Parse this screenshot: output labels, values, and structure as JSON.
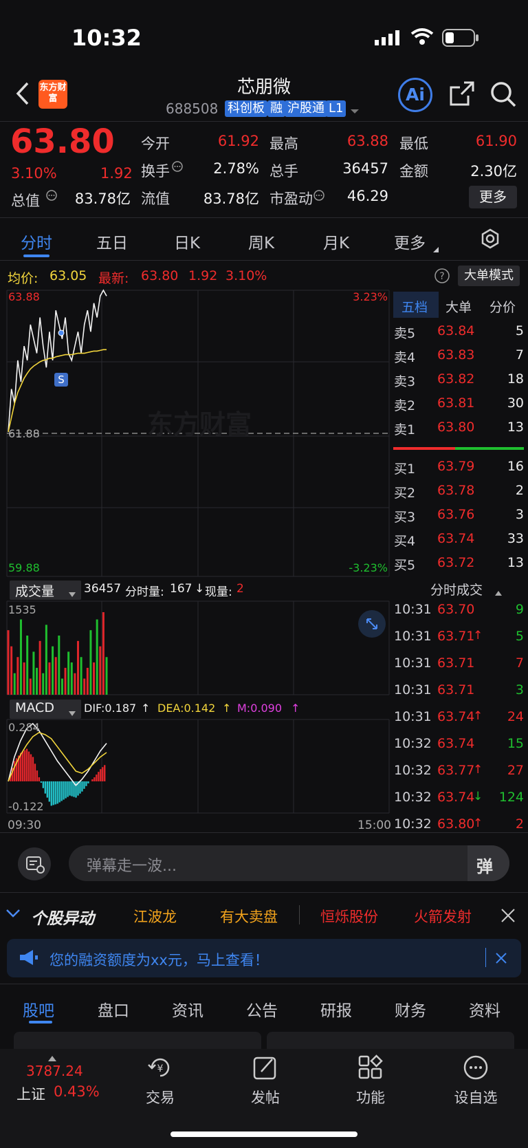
{
  "status_bar": {
    "time": "10:32"
  },
  "header": {
    "stock_name": "芯朋微",
    "stock_code": "688508",
    "tags": [
      "科创板",
      "融",
      "沪股通",
      "L1"
    ],
    "logo_text": "东方财富",
    "ai_label": "Ai"
  },
  "quote": {
    "price": "63.80",
    "change_pct": "3.10%",
    "change": "1.92",
    "fields": [
      {
        "label": "今开",
        "value": "61.92",
        "color": "#ef2c2c"
      },
      {
        "label": "最高",
        "value": "63.88",
        "color": "#ef2c2c"
      },
      {
        "label": "最低",
        "value": "61.90",
        "color": "#ef2c2c"
      },
      {
        "label": "换手",
        "value": "2.78%",
        "color": "#f1f1f1"
      },
      {
        "label": "总手",
        "value": "36457",
        "color": "#f1f1f1"
      },
      {
        "label": "金额",
        "value": "2.30亿",
        "color": "#f1f1f1"
      },
      {
        "label": "总值",
        "value": "83.78亿",
        "color": "#f1f1f1"
      },
      {
        "label": "流值",
        "value": "83.78亿",
        "color": "#f1f1f1"
      },
      {
        "label": "市盈动",
        "value": "46.29",
        "color": "#f1f1f1"
      }
    ],
    "more_button": "更多"
  },
  "chart_tabs": [
    "分时",
    "五日",
    "日K",
    "周K",
    "月K",
    "更多"
  ],
  "chart_info": {
    "avg_label": "均价:",
    "avg_value": "63.05",
    "latest_label": "最新:",
    "latest_value": "63.80",
    "latest_change": "1.92",
    "latest_pct": "3.10%",
    "bigorder_button": "大单模式"
  },
  "chart_data": [
    {
      "type": "line",
      "title": "",
      "xlabel": "",
      "ylabel": "",
      "x_range": [
        "09:30",
        "15:00"
      ],
      "ylim": [
        59.88,
        63.88
      ],
      "y_ticks": [
        "63.88",
        "61.88",
        "59.88"
      ],
      "pct_ticks": [
        "3.23%",
        "-3.23%"
      ],
      "prev_close": 61.88,
      "series": [
        {
          "name": "价格",
          "values": [
            61.9,
            62.5,
            62.3,
            62.9,
            62.6,
            63.1,
            62.9,
            63.4,
            63.2,
            63.0,
            63.5,
            63.1,
            62.8,
            63.3,
            62.9,
            63.6,
            63.4,
            63.2,
            63.5,
            63.0,
            62.9,
            63.1,
            63.3,
            63.0,
            63.4,
            63.6,
            63.3,
            63.7,
            63.5,
            63.8,
            63.88,
            63.8
          ]
        },
        {
          "name": "均价",
          "values": [
            61.9,
            62.1,
            62.3,
            62.45,
            62.55,
            62.65,
            62.72,
            62.78,
            62.82,
            62.85,
            62.88,
            62.9,
            62.91,
            62.93,
            62.93,
            62.95,
            62.96,
            62.97,
            62.98,
            62.98,
            62.98,
            62.99,
            63.0,
            63.0,
            63.0,
            63.01,
            63.02,
            63.03,
            63.03,
            63.04,
            63.05,
            63.05
          ]
        }
      ]
    },
    {
      "type": "bar",
      "title": "成交量",
      "ylim": [
        0,
        1535
      ],
      "y_ticks": [
        "1535"
      ],
      "values": [
        1200,
        900,
        400,
        700,
        1400,
        600,
        1100,
        300,
        800,
        500,
        1000,
        400,
        1300,
        600,
        900,
        700,
        1100,
        300,
        500,
        800,
        600,
        400,
        1000,
        700,
        300,
        500,
        1200,
        600,
        1400,
        900,
        1535,
        700
      ]
    },
    {
      "type": "line",
      "title": "MACD",
      "ylim": [
        -0.122,
        0.284
      ],
      "y_ticks": [
        "0.284",
        "-0.122"
      ],
      "series": [
        {
          "name": "DIF",
          "values": [
            0.0,
            0.12,
            0.2,
            0.26,
            0.284,
            0.25,
            0.2,
            0.15,
            0.1,
            0.06,
            0.02,
            -0.02,
            0.01,
            0.05,
            0.1,
            0.15,
            0.187
          ]
        },
        {
          "name": "DEA",
          "values": [
            0.0,
            0.07,
            0.13,
            0.18,
            0.22,
            0.24,
            0.23,
            0.21,
            0.17,
            0.13,
            0.09,
            0.05,
            0.04,
            0.06,
            0.09,
            0.12,
            0.142
          ]
        },
        {
          "name": "MACD",
          "values": [
            0.0,
            0.1,
            0.14,
            0.16,
            0.12,
            0.02,
            -0.06,
            -0.12,
            -0.11,
            -0.09,
            -0.07,
            -0.08,
            -0.05,
            -0.01,
            0.02,
            0.06,
            0.09
          ]
        }
      ]
    }
  ],
  "volume_info": {
    "label": "成交量",
    "total": "36457",
    "fenshi_label": "分时量:",
    "fenshi_value": "167",
    "current_label": "现量:",
    "current_value": "2"
  },
  "macd_info": {
    "label": "MACD",
    "dif": "DIF:0.187",
    "dea": "DEA:0.142",
    "m": "M:0.090"
  },
  "time_labels": {
    "start": "09:30",
    "end": "15:00"
  },
  "orderbook": {
    "tabs": [
      "五档",
      "大单",
      "分价"
    ],
    "asks": [
      {
        "label": "卖5",
        "price": "63.84",
        "vol": "5"
      },
      {
        "label": "卖4",
        "price": "63.83",
        "vol": "7"
      },
      {
        "label": "卖3",
        "price": "63.82",
        "vol": "18"
      },
      {
        "label": "卖2",
        "price": "63.81",
        "vol": "30"
      },
      {
        "label": "卖1",
        "price": "63.80",
        "vol": "13"
      }
    ],
    "bids": [
      {
        "label": "买1",
        "price": "63.79",
        "vol": "16"
      },
      {
        "label": "买2",
        "price": "63.78",
        "vol": "2"
      },
      {
        "label": "买3",
        "price": "63.76",
        "vol": "3"
      },
      {
        "label": "买4",
        "price": "63.74",
        "vol": "33"
      },
      {
        "label": "买5",
        "price": "63.72",
        "vol": "13"
      }
    ],
    "trades_title": "分时成交",
    "trades": [
      {
        "time": "10:31",
        "price": "63.70",
        "vol": "9",
        "vcolor": "#1fbf2f",
        "arrow": ""
      },
      {
        "time": "10:31",
        "price": "63.71",
        "vol": "5",
        "vcolor": "#1fbf2f",
        "arrow": "↑"
      },
      {
        "time": "10:31",
        "price": "63.71",
        "vol": "7",
        "vcolor": "#ef2c2c",
        "arrow": ""
      },
      {
        "time": "10:31",
        "price": "63.71",
        "vol": "3",
        "vcolor": "#1fbf2f",
        "arrow": ""
      },
      {
        "time": "10:31",
        "price": "63.74",
        "vol": "24",
        "vcolor": "#ef2c2c",
        "arrow": "↑"
      },
      {
        "time": "10:32",
        "price": "63.74",
        "vol": "15",
        "vcolor": "#1fbf2f",
        "arrow": ""
      },
      {
        "time": "10:32",
        "price": "63.77",
        "vol": "27",
        "vcolor": "#ef2c2c",
        "arrow": "↑"
      },
      {
        "time": "10:32",
        "price": "63.74",
        "vol": "124",
        "vcolor": "#1fbf2f",
        "arrow": "↓"
      },
      {
        "time": "10:32",
        "price": "63.80",
        "vol": "2",
        "vcolor": "#ef2c2c",
        "arrow": "↑"
      }
    ]
  },
  "danmu": {
    "placeholder": "弹幕走一波...",
    "send": "弹"
  },
  "ticker": {
    "title": "个股异动",
    "items": [
      {
        "text": "江波龙",
        "color": "#f2a31c"
      },
      {
        "text": "有大卖盘",
        "color": "#f2a31c"
      },
      {
        "text": "恒烁股份",
        "color": "#ef2c2c"
      },
      {
        "text": "火箭发射",
        "color": "#ef2c2c"
      }
    ]
  },
  "notice": {
    "text": "您的融资额度为xx元，马上查看！"
  },
  "bottom_tabs": [
    "股吧",
    "盘口",
    "资讯",
    "公告",
    "研报",
    "财务",
    "资料"
  ],
  "index": {
    "value": "3787.24",
    "name": "上证",
    "pct": "0.43%"
  },
  "nav": [
    "交易",
    "发帖",
    "功能",
    "设自选"
  ],
  "colors": {
    "accent": "#3f86f0",
    "up": "#ef2c2c",
    "down": "#1fbf2f",
    "avg": "#f2d53c"
  }
}
